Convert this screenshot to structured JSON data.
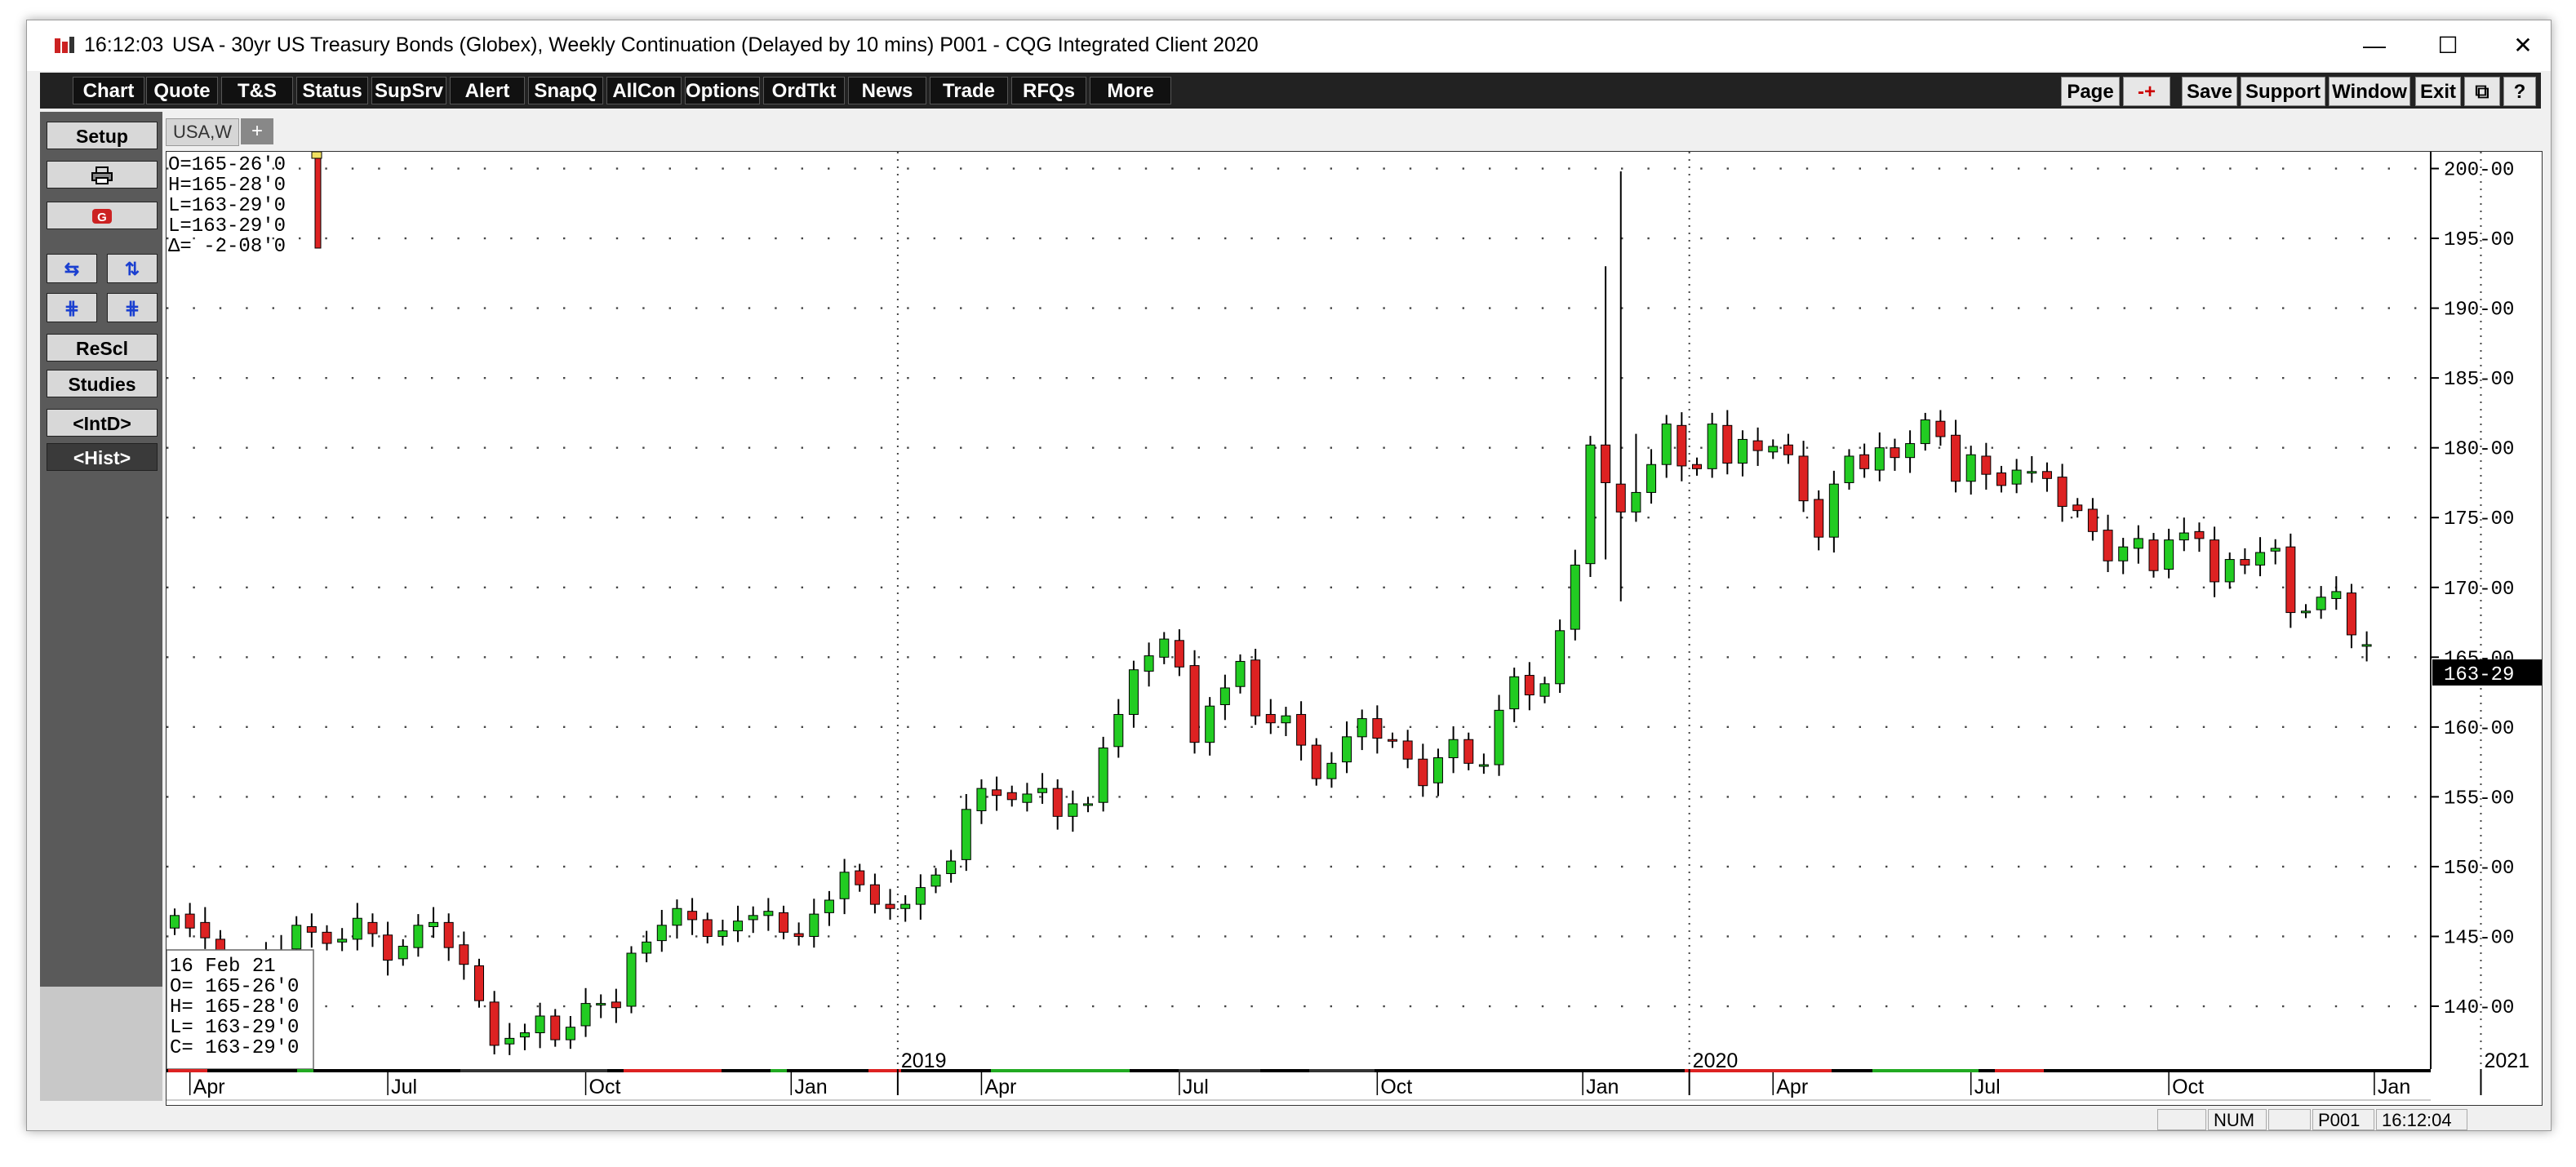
{
  "window": {
    "time": "16:12:03",
    "title": "USA - 30yr US Treasury Bonds (Globex), Weekly Continuation (Delayed by 10 mins)   P001 - CQG Integrated Client 2020",
    "controls": {
      "minimize": "—",
      "maximize": "☐",
      "close": "✕"
    }
  },
  "toolbar": {
    "left_buttons": [
      "Chart",
      "Quote",
      "T&S",
      "Status",
      "SupSrv",
      "Alert",
      "SnapQ",
      "AllCon",
      "Options",
      "OrdTkt",
      "News",
      "Trade",
      "RFQs",
      "More"
    ],
    "right_buttons": [
      "Page",
      "-+",
      "Save",
      "Support",
      "Window",
      "Exit",
      "⧉",
      "?"
    ]
  },
  "left_panel": {
    "setup": "Setup",
    "rescl": "ReScl",
    "studies": "Studies",
    "intd": "<IntD>",
    "hist": "<Hist>"
  },
  "tab": {
    "label": "USA,W",
    "add": "+"
  },
  "ohlc_top": [
    "O=165-26'0",
    "H=165-28'0",
    "L=163-29'0",
    "L=163-29'0",
    "Δ=  -2-08'0"
  ],
  "ohlc_box": [
    "16 Feb 21",
    "O=  165-26'0",
    "H=  165-28'0",
    "L=  163-29'0",
    "C=  163-29'0"
  ],
  "status": {
    "num": "NUM",
    "page": "P001",
    "time": "16:12:04"
  },
  "chart_data": {
    "type": "candlestick",
    "title": "USA - 30yr US Treasury Bonds (Globex), Weekly Continuation",
    "y_tick_labels": [
      "200-00",
      "195-00",
      "190-00",
      "185-00",
      "180-00",
      "175-00",
      "170-00",
      "165-00",
      "160-00",
      "155-00",
      "150-00",
      "145-00",
      "140-00"
    ],
    "ylim": [
      135.5,
      201.2
    ],
    "last_price_label": "163-29",
    "last_price": 163.906,
    "year_labels": [
      {
        "label": "2019",
        "week": 48
      },
      {
        "label": "2020",
        "week": 100
      },
      {
        "label": "2021",
        "week": 152
      }
    ],
    "month_labels": [
      {
        "label": "Apr",
        "week": 1.5
      },
      {
        "label": "Jul",
        "week": 14.5
      },
      {
        "label": "Oct",
        "week": 27.5
      },
      {
        "label": "Jan",
        "week": 41
      },
      {
        "label": "Apr",
        "week": 53.5
      },
      {
        "label": "Jul",
        "week": 66.5
      },
      {
        "label": "Oct",
        "week": 79.5
      },
      {
        "label": "Jan",
        "week": 93
      },
      {
        "label": "Apr",
        "week": 105.5
      },
      {
        "label": "Jul",
        "week": 118.5
      },
      {
        "label": "Oct",
        "week": 131.5
      },
      {
        "label": "Jan",
        "week": 145
      }
    ],
    "closes": [
      146.5,
      145.6,
      144.9,
      142.8,
      143.0,
      142.8,
      143.8,
      144.0,
      145.8,
      145.3,
      144.5,
      144.8,
      146.3,
      145.2,
      143.3,
      144.3,
      145.8,
      146.0,
      144.2,
      143.0,
      140.4,
      137.2,
      137.7,
      138.1,
      139.3,
      137.6,
      138.5,
      140.2,
      140.2,
      139.9,
      143.8,
      144.6,
      145.8,
      147.0,
      146.2,
      145.0,
      145.4,
      146.1,
      146.5,
      146.8,
      145.3,
      145.0,
      146.6,
      147.6,
      149.6,
      148.7,
      147.3,
      147.0,
      147.3,
      148.5,
      149.4,
      150.4,
      154.1,
      155.6,
      155.1,
      154.8,
      155.2,
      155.6,
      153.6,
      154.5,
      154.5,
      158.5,
      160.9,
      164.1,
      165.1,
      166.3,
      164.3,
      158.9,
      161.5,
      162.8,
      164.7,
      160.8,
      160.3,
      160.8,
      158.7,
      156.3,
      157.4,
      159.3,
      160.6,
      159.2,
      159.0,
      157.7,
      155.8,
      157.8,
      159.1,
      157.4,
      157.3,
      161.2,
      163.6,
      162.3,
      163.1,
      166.9,
      171.6,
      180.2,
      177.5,
      175.4,
      176.8,
      178.8,
      181.7,
      178.7,
      178.5,
      181.7,
      178.9,
      180.6,
      179.8,
      180.1,
      179.5,
      176.2,
      173.6,
      177.4,
      179.4,
      178.5,
      180.0,
      179.3,
      180.3,
      182.0,
      180.8,
      177.6,
      179.5,
      178.1,
      177.3,
      178.4,
      178.3,
      177.8,
      175.8,
      175.5,
      174.0,
      171.9,
      172.9,
      173.5,
      171.2,
      173.4,
      173.9,
      173.5,
      170.4,
      172.0,
      171.6,
      172.5,
      172.8,
      168.2,
      168.3,
      169.3,
      169.7,
      166.6,
      165.9,
      163.9
    ],
    "opens": [
      145.6,
      146.6,
      146.0,
      144.8,
      142.7,
      143.2,
      142.8,
      143.7,
      144.1,
      145.7,
      145.3,
      144.6,
      144.8,
      146.0,
      145.1,
      143.4,
      144.2,
      145.7,
      146.0,
      144.4,
      142.9,
      140.3,
      137.3,
      137.8,
      138.1,
      139.3,
      137.6,
      138.6,
      140.1,
      140.3,
      140.0,
      143.8,
      144.7,
      145.8,
      146.8,
      146.2,
      145.0,
      145.4,
      146.2,
      146.5,
      146.7,
      145.2,
      145.0,
      146.7,
      147.7,
      149.7,
      148.7,
      147.3,
      147.0,
      147.3,
      148.6,
      149.5,
      150.5,
      154.0,
      155.5,
      155.3,
      154.6,
      155.3,
      155.6,
      153.6,
      154.4,
      154.6,
      158.6,
      160.9,
      164.0,
      165.0,
      166.2,
      164.4,
      158.9,
      161.6,
      162.9,
      164.8,
      160.9,
      160.3,
      160.9,
      158.7,
      156.3,
      157.5,
      159.3,
      160.6,
      159.1,
      159.0,
      157.7,
      156.0,
      157.8,
      159.1,
      157.3,
      157.3,
      161.3,
      163.7,
      162.2,
      163.1,
      167.0,
      171.7,
      180.2,
      177.4,
      175.4,
      176.8,
      178.8,
      181.6,
      178.8,
      178.5,
      181.6,
      178.9,
      180.5,
      179.7,
      180.2,
      179.4,
      176.3,
      173.6,
      177.5,
      179.5,
      178.4,
      180.0,
      179.3,
      180.3,
      181.9,
      180.9,
      177.6,
      179.4,
      178.2,
      177.4,
      178.3,
      178.3,
      177.9,
      175.9,
      175.6,
      174.1,
      171.9,
      172.8,
      173.4,
      171.3,
      173.4,
      174.0,
      173.4,
      170.4,
      172.0,
      171.6,
      172.6,
      172.9,
      168.3,
      168.4,
      169.2,
      169.6,
      165.8
    ]
  }
}
